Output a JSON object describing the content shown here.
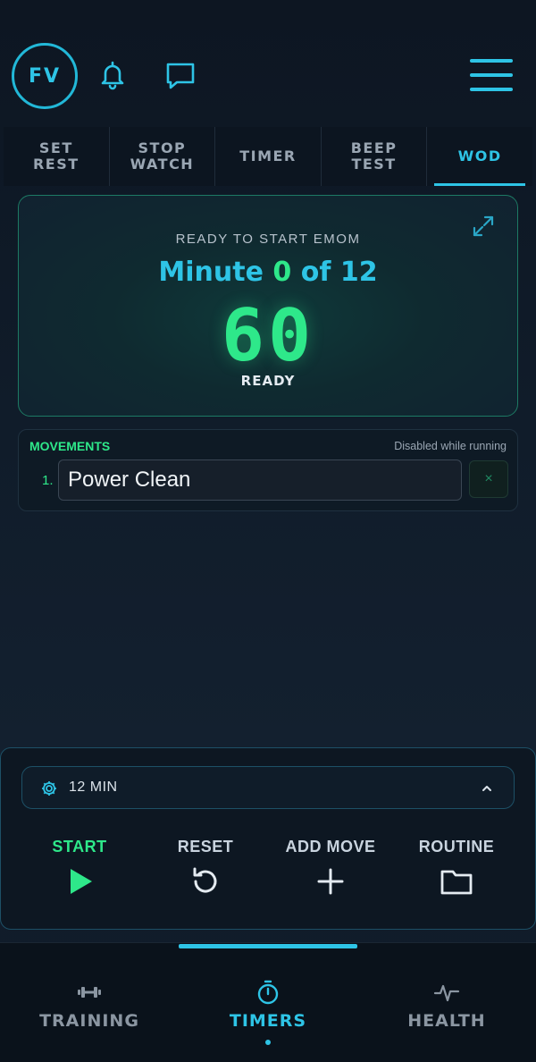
{
  "header": {
    "avatar_initials": "FV",
    "icons": [
      "bell-icon",
      "chat-icon",
      "menu-icon"
    ]
  },
  "tabs": [
    {
      "label": "SET\nREST",
      "active": false
    },
    {
      "label": "STOP\nWATCH",
      "active": false
    },
    {
      "label": "TIMER",
      "active": false
    },
    {
      "label": "BEEP\nTEST",
      "active": false
    },
    {
      "label": "WOD",
      "active": true
    }
  ],
  "timer": {
    "status": "READY TO START EMOM",
    "minute_prefix": "Minute",
    "minute_current": "0",
    "minute_suffix": "of 12",
    "countdown": "60",
    "state": "READY"
  },
  "movements": {
    "title": "MOVEMENTS",
    "note": "Disabled while running",
    "items": [
      {
        "number": "1.",
        "value": "Power Clean"
      }
    ],
    "delete_label": "×"
  },
  "settings": {
    "duration_label": "12 MIN"
  },
  "controls": {
    "start": "START",
    "reset": "RESET",
    "add_move": "ADD MOVE",
    "routine": "ROUTINE"
  },
  "bottom_nav": [
    {
      "label": "TRAINING",
      "icon": "dumbbell-icon",
      "active": false
    },
    {
      "label": "TIMERS",
      "icon": "stopwatch-icon",
      "active": true
    },
    {
      "label": "HEALTH",
      "icon": "pulse-icon",
      "active": false
    }
  ],
  "colors": {
    "accent_cyan": "#2ec4e6",
    "accent_green": "#2ee88a",
    "background": "#0d1622"
  }
}
